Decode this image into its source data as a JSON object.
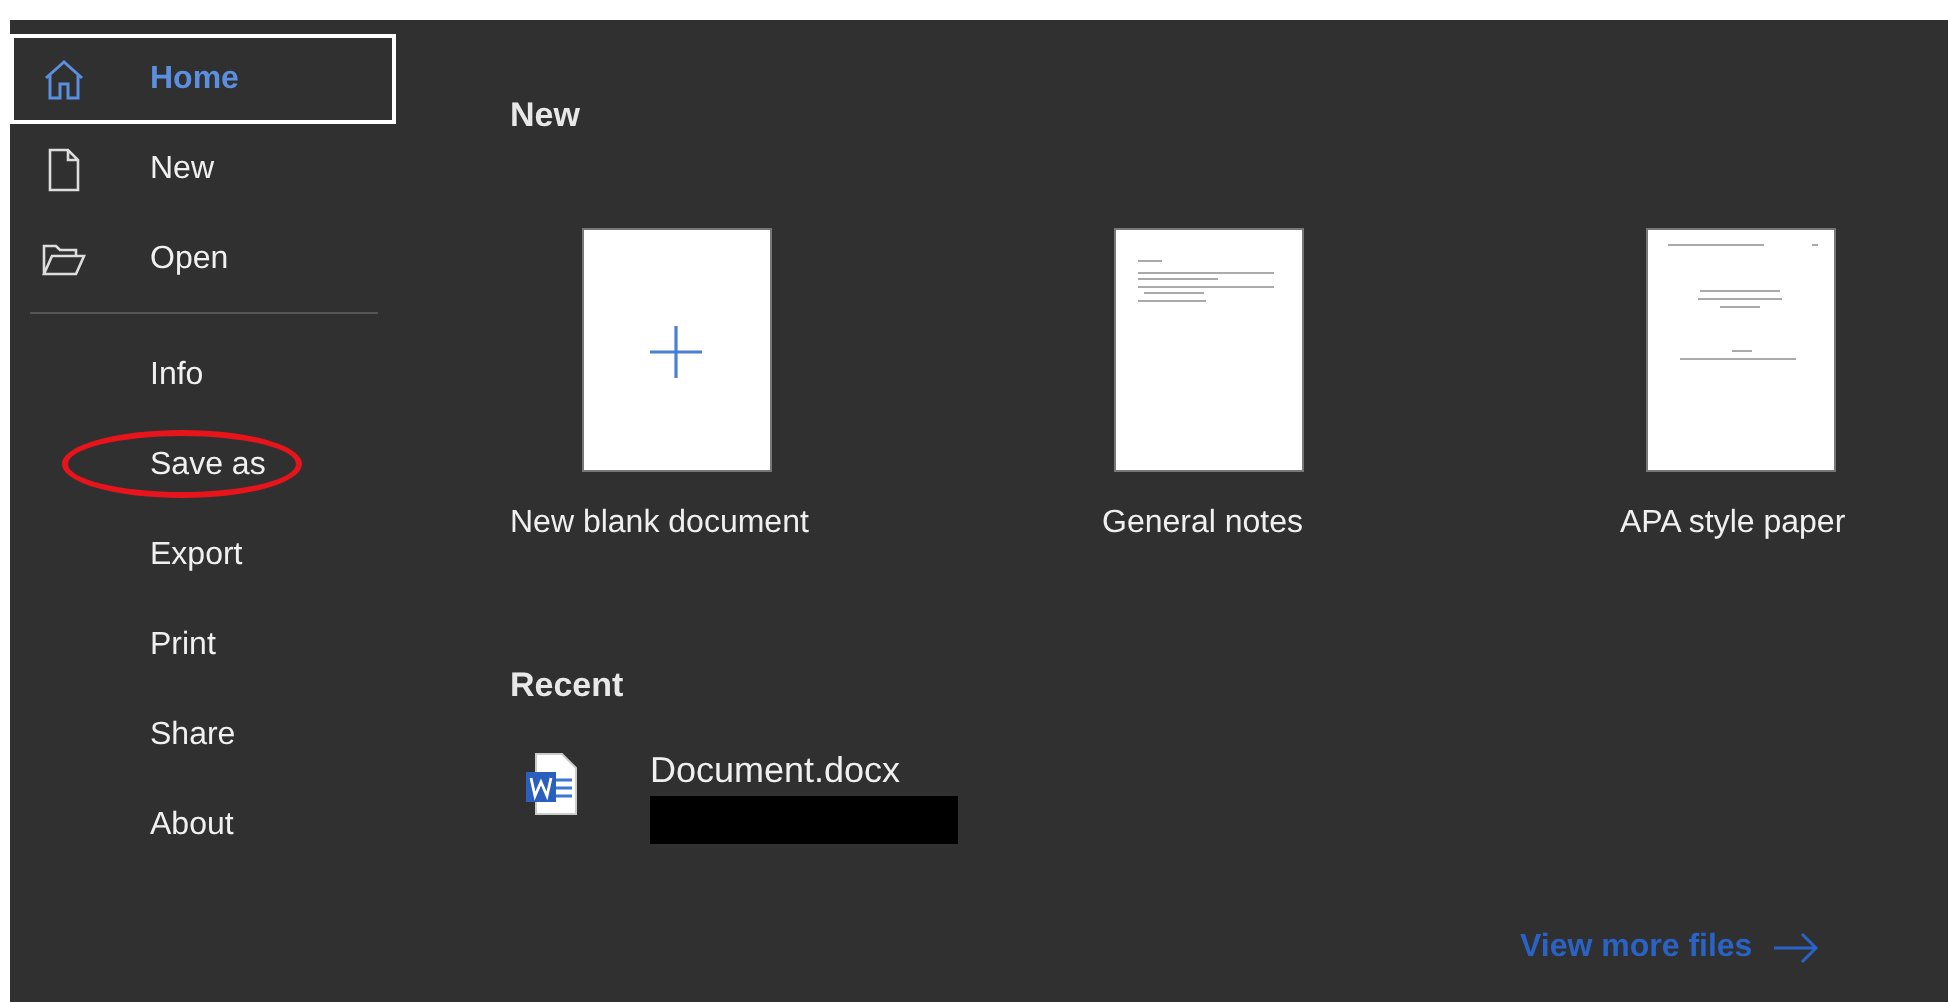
{
  "sidebar": {
    "items": [
      {
        "label": "Home",
        "kind": "home",
        "selected": true
      },
      {
        "label": "New",
        "kind": "page",
        "selected": false
      },
      {
        "label": "Open",
        "kind": "folder",
        "selected": false
      },
      {
        "label": "Info",
        "kind": "text",
        "selected": false
      },
      {
        "label": "Save as",
        "kind": "text",
        "selected": false,
        "circled": true
      },
      {
        "label": "Export",
        "kind": "text",
        "selected": false
      },
      {
        "label": "Print",
        "kind": "text",
        "selected": false
      },
      {
        "label": "Share",
        "kind": "text",
        "selected": false
      },
      {
        "label": "About",
        "kind": "text",
        "selected": false
      }
    ]
  },
  "new_section": {
    "title": "New",
    "templates": [
      {
        "label": "New blank document",
        "kind": "blank"
      },
      {
        "label": "General notes",
        "kind": "notes"
      },
      {
        "label": "APA style paper",
        "kind": "paper"
      }
    ]
  },
  "recent_section": {
    "title": "Recent",
    "files": [
      {
        "name": "Document.docx",
        "redacted": true
      }
    ]
  },
  "view_more": "View more files"
}
